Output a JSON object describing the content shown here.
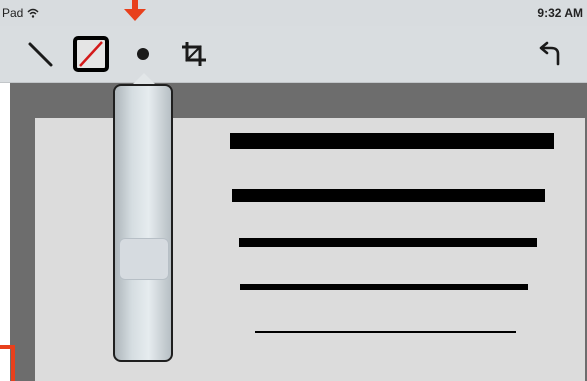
{
  "status": {
    "carrier": "Pad",
    "time": "9:32 AM",
    "wifi_icon": "wifi-icon"
  },
  "toolbar": {
    "tools": [
      {
        "name": "line-tool-icon"
      },
      {
        "name": "box-no-fill-icon"
      },
      {
        "name": "dot-size-icon"
      },
      {
        "name": "crop-icon"
      },
      {
        "name": "undo-icon"
      }
    ]
  },
  "popover": {
    "type": "stroke-width-slider",
    "thumb_level": 0.5
  },
  "canvas": {
    "background": "#dcdcdc",
    "frame_color": "#6d6d6d",
    "stroke_color": "#000000",
    "stroke_samples": 5
  },
  "annotations": {
    "accent": "#e8401c"
  }
}
